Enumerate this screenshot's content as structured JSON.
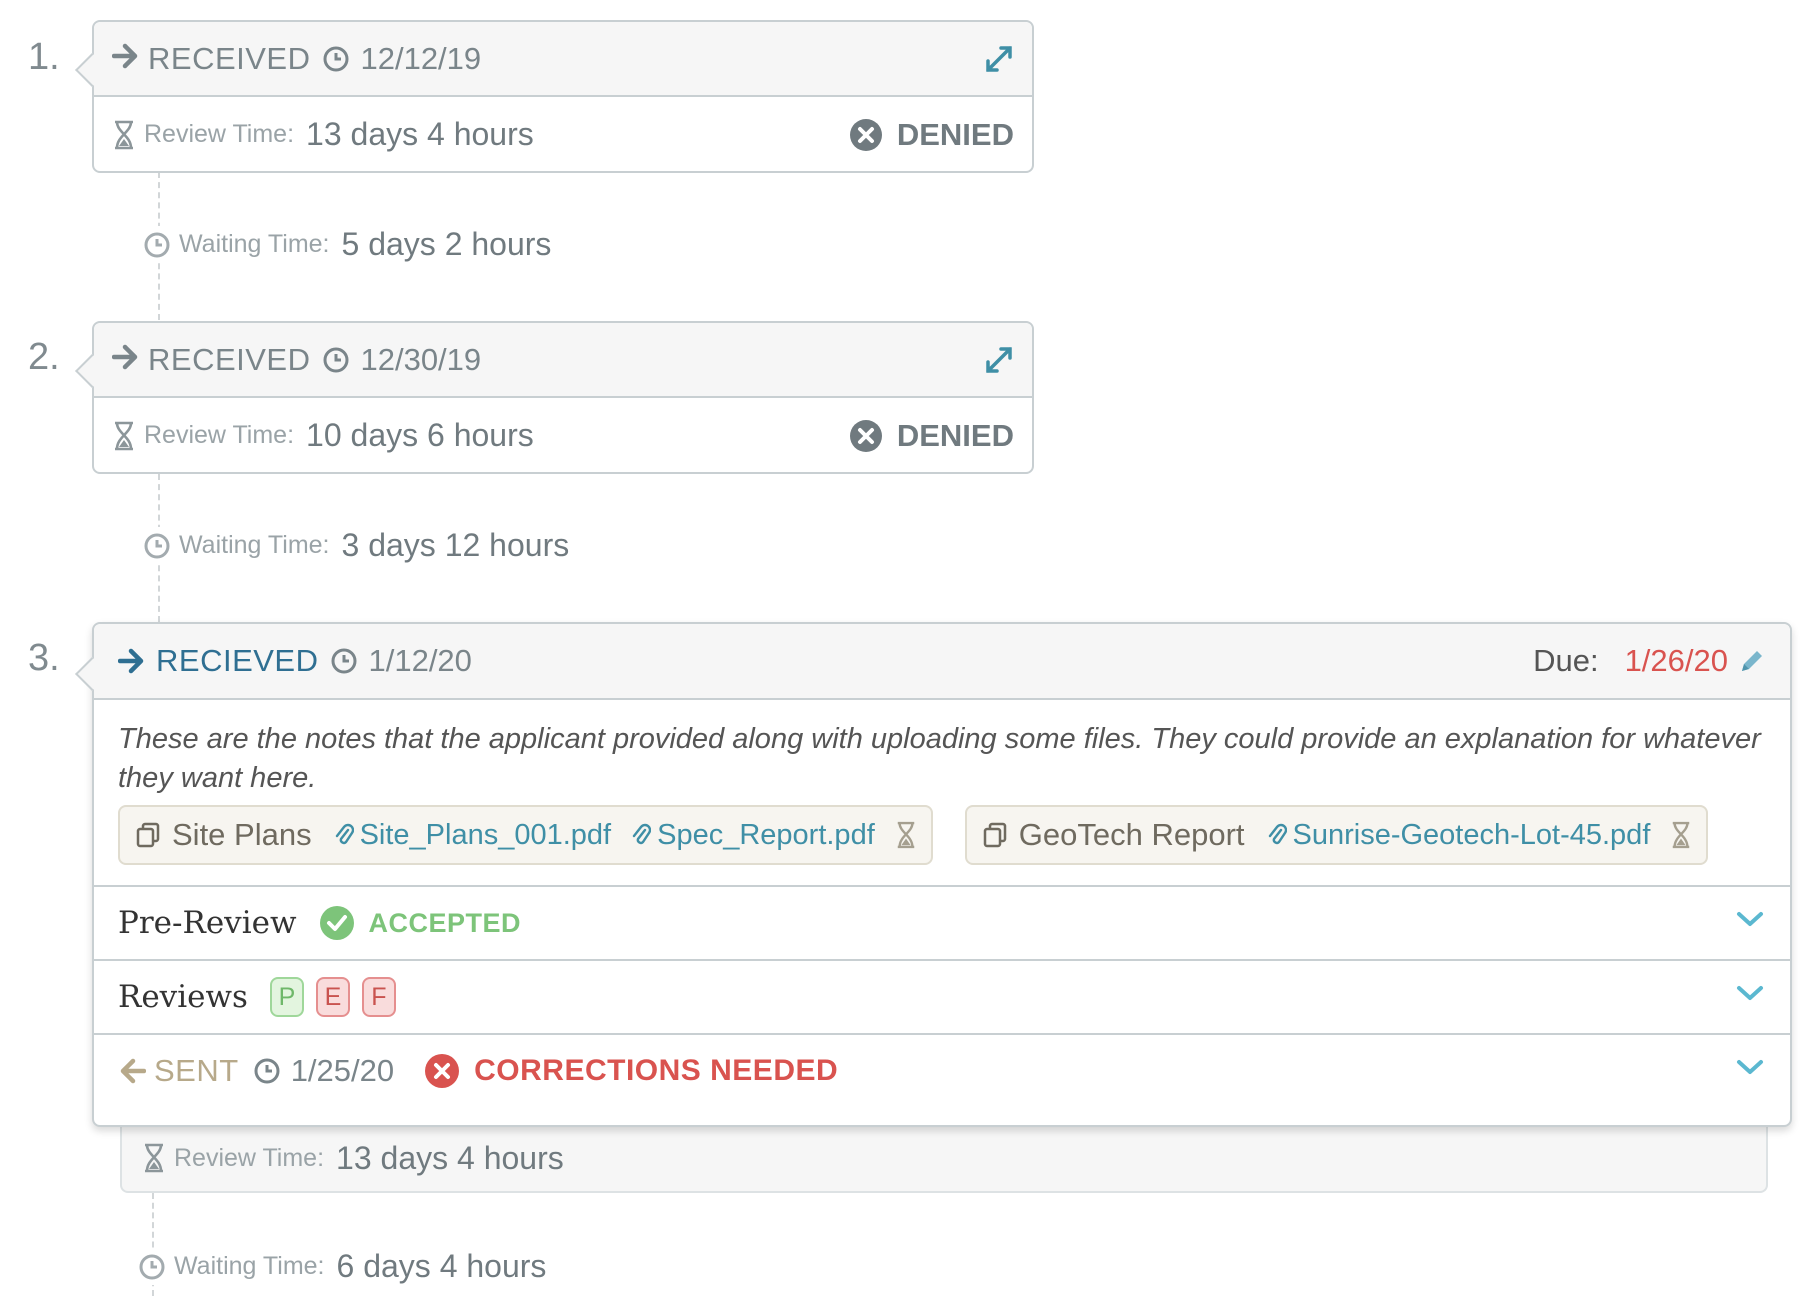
{
  "steps": [
    {
      "number": "1.",
      "status_label": "RECEIVED",
      "date": "12/12/19",
      "review_time_label": "Review Time:",
      "review_time": "13 days 4 hours",
      "outcome": "DENIED"
    },
    {
      "number": "2.",
      "status_label": "RECEIVED",
      "date": "12/30/19",
      "review_time_label": "Review Time:",
      "review_time": "10 days 6 hours",
      "outcome": "DENIED"
    },
    {
      "number": "3.",
      "status_label": "RECIEVED",
      "date": "1/12/20",
      "due_label": "Due:",
      "due_date": "1/26/20",
      "notes": "These are the notes that the applicant provided along with uploading some files. They could provide an explanation for whatever they want here.",
      "file_groups": [
        {
          "name": "Site Plans",
          "files": [
            "Site_Plans_001.pdf",
            "Spec_Report.pdf"
          ]
        },
        {
          "name": "GeoTech Report",
          "files": [
            "Sunrise-Geotech-Lot-45.pdf"
          ]
        }
      ],
      "pre_review": {
        "title": "Pre-Review",
        "status": "ACCEPTED"
      },
      "reviews": {
        "title": "Reviews",
        "badges": [
          "P",
          "E",
          "F"
        ]
      },
      "sent": {
        "label": "SENT",
        "date": "1/25/20",
        "status": "CORRECTIONS NEEDED"
      },
      "review_time_label": "Review Time:",
      "review_time": "13 days 4 hours"
    }
  ],
  "waits": [
    {
      "label": "Waiting Time:",
      "value": "5 days 2 hours"
    },
    {
      "label": "Waiting Time:",
      "value": "3 days 12 hours"
    },
    {
      "label": "Waiting Time:",
      "value": "6 days 4 hours"
    }
  ],
  "colors": {
    "accent_blue": "#2f6f92",
    "link_teal": "#3f8fa6",
    "accepted_green": "#7dc47a",
    "danger_red": "#d9534f",
    "muted_gray": "#707a7f"
  },
  "icons": {
    "received": "arrow-right-icon",
    "clock": "clock-icon",
    "expand": "expand-icon",
    "hourglass": "hourglass-icon",
    "denied": "x-circle-icon",
    "edit": "pencil-icon",
    "file_group": "copy-icon",
    "attachment": "paperclip-icon",
    "accepted": "check-circle-icon",
    "chevron": "chevron-down-icon",
    "sent": "arrow-left-icon"
  }
}
